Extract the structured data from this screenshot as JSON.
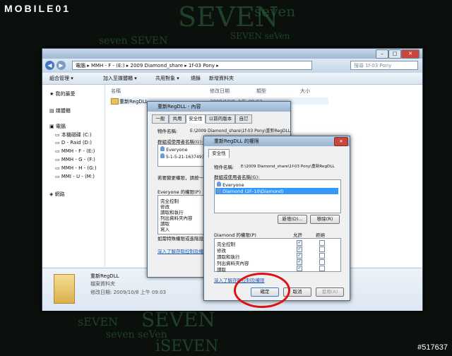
{
  "brand": {
    "logo_text": "MOBILE01",
    "watermark": "#517637"
  },
  "wallpaper": {
    "words": [
      "SEVEN",
      "seven SEVEN",
      "SEVEN seVen",
      "seven",
      "sEVEN",
      "SEVEN",
      "seven seVen",
      "iSEVEN"
    ]
  },
  "explorer": {
    "breadcrumb": [
      "電腦",
      "MMH - F - (E:)",
      "2009 Diamond_share",
      "1f-03 Pony"
    ],
    "search_placeholder": "搜尋 1f-03 Pony",
    "toolbar": [
      "組合管理 ▾",
      "加入至媒體櫃 ▾",
      "共用對象 ▾",
      "燒錄",
      "新增資料夾"
    ],
    "nav": {
      "favorites": "我的最愛",
      "libraries": "媒體櫃",
      "computer": "電腦",
      "drives": [
        "本機磁碟 (C:)",
        "D - Raid (D:)",
        "MMH - F - (E:)",
        "MMH - G - (F:)",
        "MMH - H - (G:)",
        "MMI - U - (M:)"
      ],
      "network": "網路"
    },
    "columns": [
      "名稱",
      "修改日期",
      "類型",
      "大小"
    ],
    "files": [
      {
        "name": "重新RegDLL",
        "modified": "2009/10/8 上午 09:03"
      }
    ],
    "details": {
      "name": "重新RegDLL",
      "type": "檔案資料夾",
      "modified_label": "修改日期: 2009/10/8 上午 09:03"
    }
  },
  "props_dialog": {
    "title": "重新RegDLL - 內容",
    "tabs": [
      "一般",
      "共用",
      "安全性",
      "以前的版本",
      "自訂"
    ],
    "object_label": "物件名稱:",
    "object_value": "E:\\2009 Diamond_share\\1f-03 Pony\\重新RegDLL",
    "group_label": "群組或使用者名稱(G):",
    "users": [
      "Everyone",
      "S-1-5-21-16374937"
    ],
    "change_hint": "若要變更權限，請按一",
    "perm_label": "Everyone 的權限(P)",
    "perms": [
      "完全控制",
      "修改",
      "讀取和執行",
      "列出資料夾內容",
      "讀取",
      "寫入"
    ],
    "special_hint": "如需特殊權限或進階設",
    "link": "深入了解存取控制及權"
  },
  "perm_dialog": {
    "title": "重新RegDLL 的權限",
    "tab": "安全性",
    "object_label": "物件名稱:",
    "object_value": "E:\\2009 Diamond_share\\1f-03 Pony\\重新RegDLL",
    "group_label": "群組或使用者名稱(G):",
    "users": [
      "Everyone",
      "Diamond (2F-10\\Diamond)"
    ],
    "add_button": "新增(D)...",
    "remove_button": "移除(R)",
    "perm_label": "Diamond 的權限(P)",
    "allow_header": "允許",
    "deny_header": "拒絕",
    "perms": [
      "完全控制",
      "修改",
      "讀取和執行",
      "列出資料夾內容",
      "讀取"
    ],
    "allow_checked": [
      true,
      true,
      true,
      true,
      true
    ],
    "link": "深入了解存取控制及權限",
    "ok": "確定",
    "cancel": "取消",
    "apply": "套用(A)"
  },
  "colors": {
    "highlight": "#3399ff",
    "circle": "#e01010"
  }
}
